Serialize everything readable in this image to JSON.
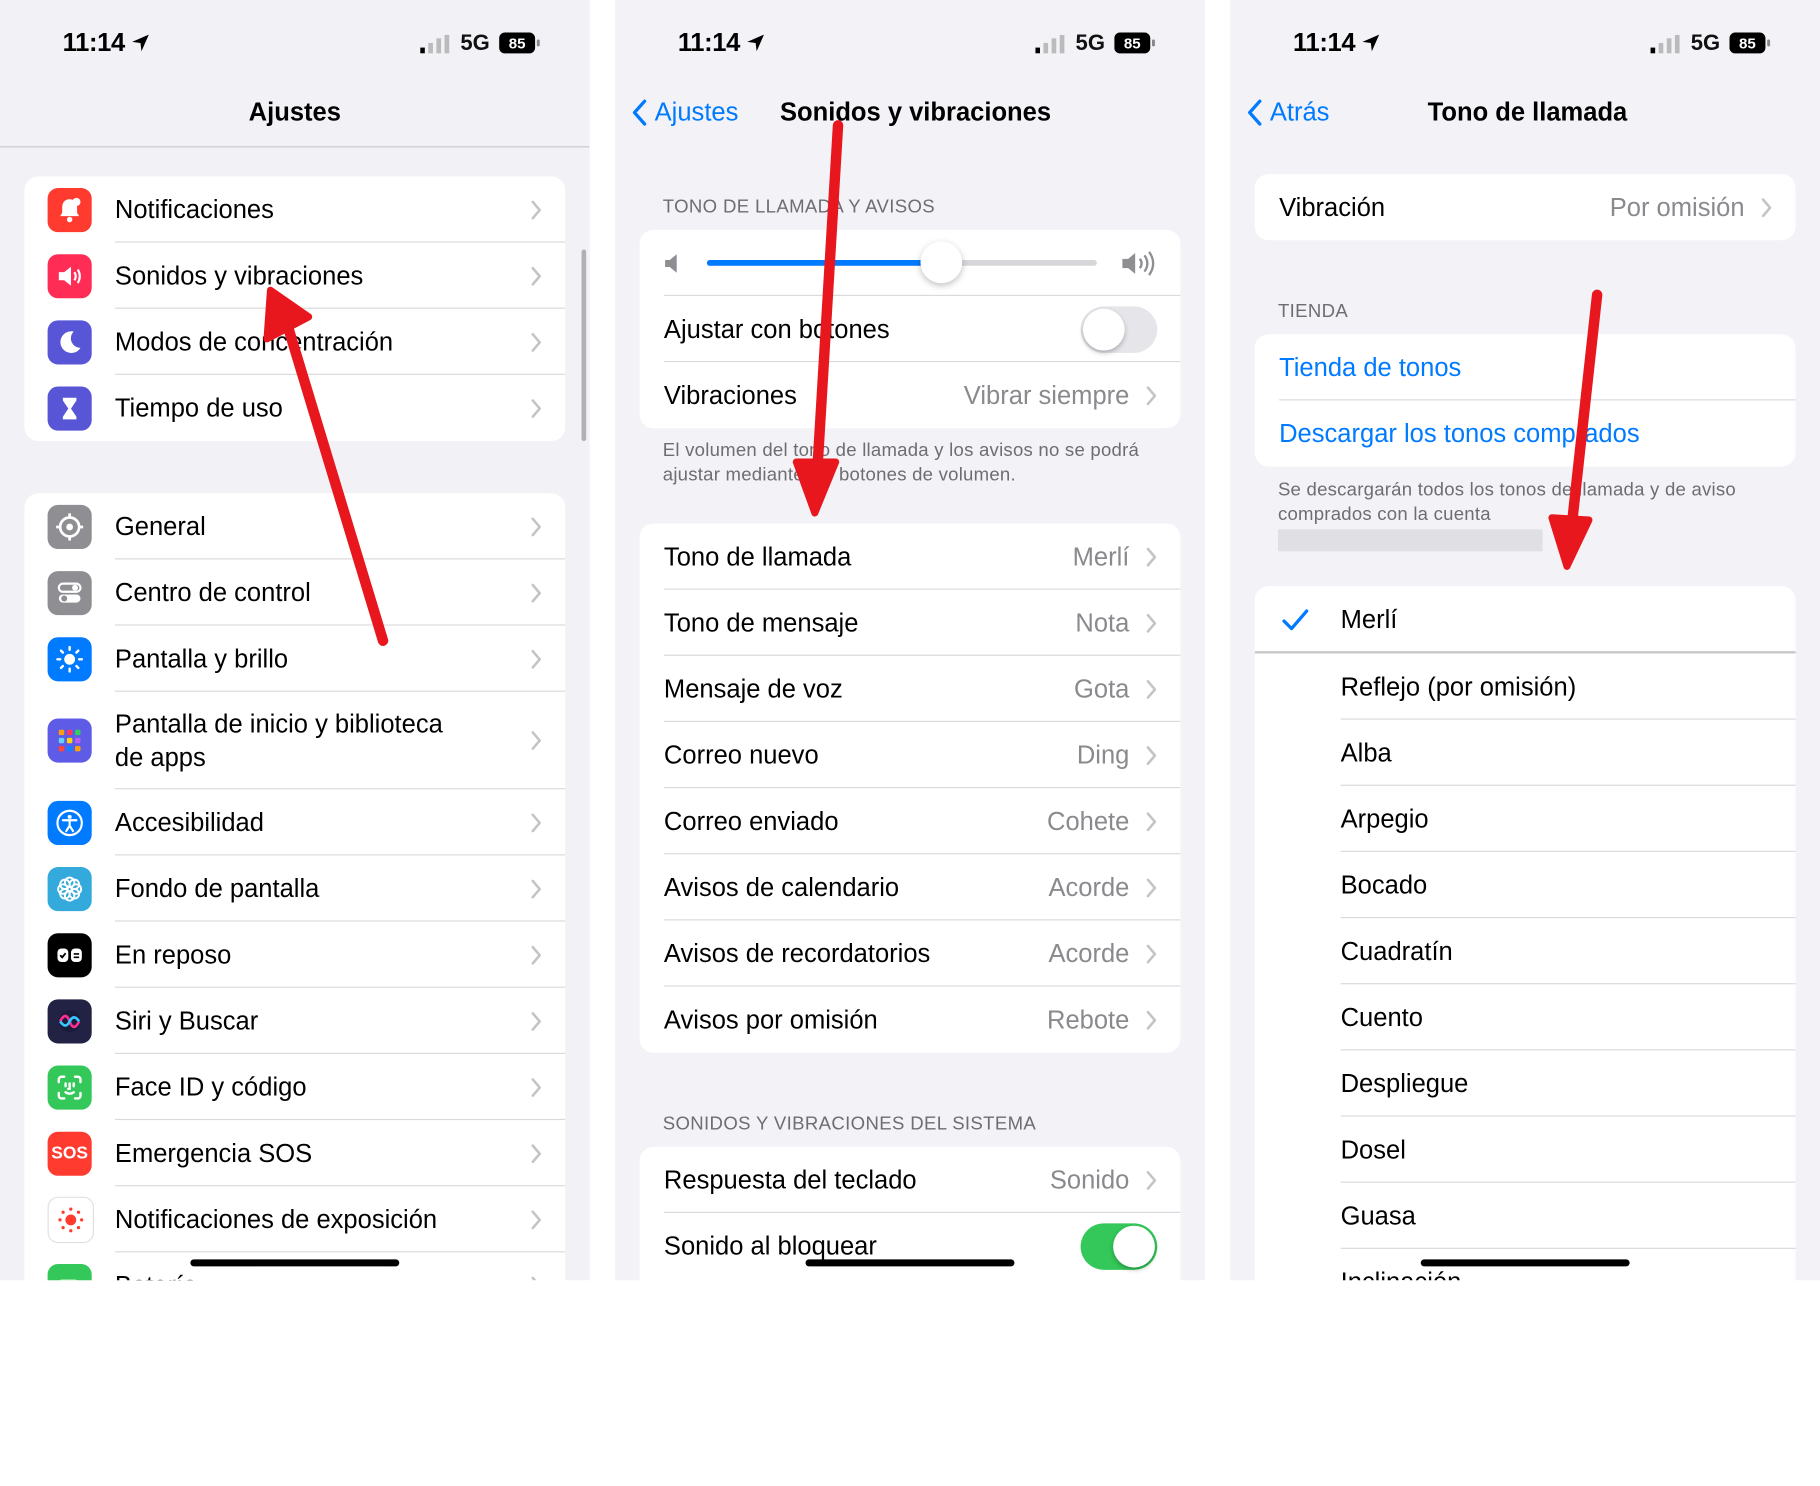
{
  "status": {
    "time": "11:14",
    "network": "5G",
    "battery": "85"
  },
  "settings": {
    "title": "Ajustes",
    "group1": [
      {
        "label": "Notificaciones",
        "icon": "bell-icon",
        "color": "#ff3b30"
      },
      {
        "label": "Sonidos y vibraciones",
        "icon": "speaker-icon",
        "color": "#ff2d55"
      },
      {
        "label": "Modos de concentración",
        "icon": "moon-icon",
        "color": "#5856d6"
      },
      {
        "label": "Tiempo de uso",
        "icon": "hourglass-icon",
        "color": "#5856d6"
      }
    ],
    "group2": [
      {
        "label": "General",
        "icon": "gear-icon",
        "color": "#8e8e93"
      },
      {
        "label": "Centro de control",
        "icon": "toggles-icon",
        "color": "#8e8e93"
      },
      {
        "label": "Pantalla y brillo",
        "icon": "sun-icon",
        "color": "#007aff"
      },
      {
        "label": "Pantalla de inicio y biblioteca",
        "label2": "de apps",
        "icon": "app-grid-icon",
        "color": "#5e5ce6"
      },
      {
        "label": "Accesibilidad",
        "icon": "accessibility-icon",
        "color": "#007aff"
      },
      {
        "label": "Fondo de pantalla",
        "icon": "flower-icon",
        "color": "#34aadc"
      },
      {
        "label": "En reposo",
        "icon": "standby-icon",
        "color": "#000000"
      },
      {
        "label": "Siri y Buscar",
        "icon": "siri-icon",
        "color": "#222244"
      },
      {
        "label": "Face ID y código",
        "icon": "face-id-icon",
        "color": "#34c759"
      },
      {
        "label": "Emergencia SOS",
        "icon": "sos-icon",
        "color": "#ff3b30",
        "icon_text": "SOS"
      },
      {
        "label": "Notificaciones de exposición",
        "icon": "exposure-icon",
        "color": "#ffffff"
      },
      {
        "label": "Batería",
        "icon": "battery-icon",
        "color": "#34c759"
      }
    ]
  },
  "sounds": {
    "back": "Ajustes",
    "title": "Sonidos y vibraciones",
    "section1": "TONO DE LLAMADA Y AVISOS",
    "volume": 0.6,
    "adjust_label": "Ajustar con botones",
    "adjust_on": false,
    "vibr_label": "Vibraciones",
    "vibr_value": "Vibrar siempre",
    "note": "El volumen del tono de llamada y los avisos no se podrá ajustar mediante los botones de volumen.",
    "tones": [
      {
        "label": "Tono de llamada",
        "value": "Merlí"
      },
      {
        "label": "Tono de mensaje",
        "value": "Nota"
      },
      {
        "label": "Mensaje de voz",
        "value": "Gota"
      },
      {
        "label": "Correo nuevo",
        "value": "Ding"
      },
      {
        "label": "Correo enviado",
        "value": "Cohete"
      },
      {
        "label": "Avisos de calendario",
        "value": "Acorde"
      },
      {
        "label": "Avisos de recordatorios",
        "value": "Acorde"
      },
      {
        "label": "Avisos por omisión",
        "value": "Rebote"
      }
    ],
    "section2": "SONIDOS Y VIBRACIONES DEL SISTEMA",
    "keyboard_label": "Respuesta del teclado",
    "keyboard_value": "Sonido",
    "lock_label": "Sonido al bloquear",
    "lock_on": true
  },
  "ringtone": {
    "back": "Atrás",
    "title": "Tono de llamada",
    "vibration_label": "Vibración",
    "vibration_value": "Por omisión",
    "store_header": "TIENDA",
    "store_link": "Tienda de tonos",
    "download_link": "Descargar los tonos comprados",
    "store_note": "Se descargarán todos los tonos de llamada y de aviso comprados con la cuenta",
    "selected": "Merlí",
    "tones": [
      "Reflejo (por omisión)",
      "Alba",
      "Arpegio",
      "Bocado",
      "Cuadratín",
      "Cuento",
      "Despliegue",
      "Dosel",
      "Guasa",
      "Inclinación"
    ]
  },
  "colors": {
    "accent": "#007aff",
    "switch_on": "#34c759",
    "annotation": "#e8171e"
  }
}
